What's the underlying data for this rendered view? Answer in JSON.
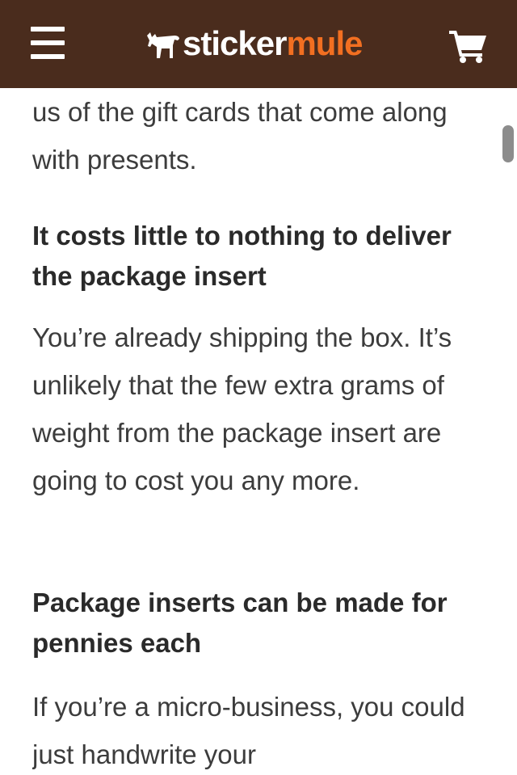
{
  "header": {
    "logo_sticker": "sticker",
    "logo_mule": "mule",
    "brand_color": "#4a2c1d",
    "accent_color": "#f26f21",
    "menu_icon": "hamburger-menu-icon",
    "cart_icon": "shopping-cart-icon"
  },
  "article": {
    "intro_tail": "us of the gift cards that come along with presents.",
    "section1_heading": "It costs little to nothing to deliver the package insert",
    "section1_body": "You’re already shipping the box. It’s unlikely that the few extra grams of weight from the package insert are going to cost you any more.",
    "section2_heading": "Package inserts can be made for pennies each",
    "section2_body": "If you’re a micro-business, you could just handwrite your"
  }
}
